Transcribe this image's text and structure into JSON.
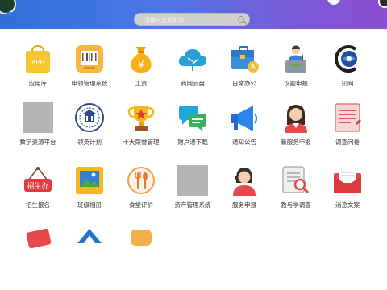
{
  "search": {
    "placeholder": "请输入应用名称"
  },
  "apps": {
    "r1": [
      {
        "label": "应用库",
        "icon": "app-store-bag-icon"
      },
      {
        "label": "申领管理系统",
        "icon": "barcode-package-icon"
      },
      {
        "label": "工资",
        "icon": "money-bag-icon"
      },
      {
        "label": "商网云盘",
        "icon": "cloud-tree-icon"
      },
      {
        "label": "日常办公",
        "icon": "briefcase-clock-icon"
      },
      {
        "label": "议题申报",
        "icon": "podium-speaker-icon"
      },
      {
        "label": "知网",
        "icon": "cnki-logo-icon"
      }
    ],
    "r2": [
      {
        "label": "数字资源平台",
        "icon": "placeholder-icon"
      },
      {
        "label": "领英计划",
        "icon": "university-emblem-icon"
      },
      {
        "label": "十大荣誉管理",
        "icon": "trophy-icon"
      },
      {
        "label": "财户通下载",
        "icon": "chat-bubbles-icon"
      },
      {
        "label": "通知公告",
        "icon": "megaphone-icon"
      },
      {
        "label": "新服务申报",
        "icon": "service-woman-icon"
      },
      {
        "label": "调查问卷",
        "icon": "survey-form-icon"
      }
    ],
    "r3": [
      {
        "label": "招生报名",
        "icon": "enrollment-sign-icon"
      },
      {
        "label": "班级相册",
        "icon": "photo-album-icon"
      },
      {
        "label": "食堂评价",
        "icon": "cutlery-icon"
      },
      {
        "label": "资产管理系统",
        "icon": "placeholder-icon"
      },
      {
        "label": "服务申报",
        "icon": "support-agent-icon"
      },
      {
        "label": "教与学调查",
        "icon": "document-search-icon"
      },
      {
        "label": "消息文案",
        "icon": "envelope-icon"
      }
    ]
  },
  "colors": {
    "topbar_start": "#2f6fd8",
    "topbar_end": "#8b4fd2",
    "label": "#333333"
  }
}
